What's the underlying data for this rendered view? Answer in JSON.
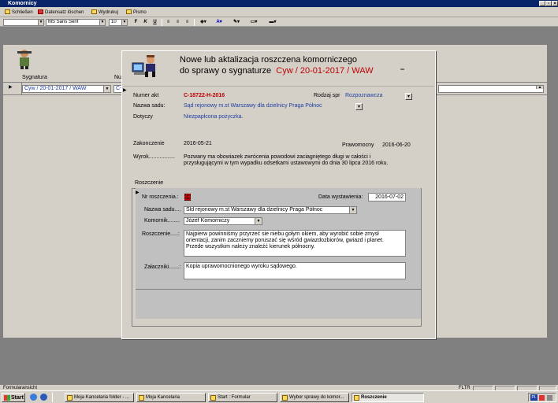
{
  "window": {
    "title": "Komornicy"
  },
  "menu": {
    "items": [
      "Schließen",
      "Datensatz löschen",
      "Wydrukuj",
      "Pismo"
    ]
  },
  "format": {
    "font": "MS Sans Serif",
    "size": "10",
    "bold": "F",
    "italic": "K",
    "underline": "U"
  },
  "background_form": {
    "label_syg": "Sygnatura",
    "label_nu": "Nu",
    "row_value": "Cyw / 20-01-2017 / WAW",
    "row_value2": "C-"
  },
  "dialog": {
    "title_line1": "Nowe lub aktalizacja roszczena  komorniczego",
    "title_line2_prefix": "do sprawy o sygnaturze",
    "title_line2_sig": "Cyw / 20-01-2017 / WAW",
    "numer_akt_label": "Numer akt",
    "numer_akt_value": "C-18722-H-2016",
    "rodzaj_label": "Rodzaj spr",
    "rodzaj_value": "Rozpoznawcza",
    "nazwa_sadu_label": "Nazwa sadu:",
    "nazwa_sadu_value": "Sąd rejonowy m.st  Warszawy dla dzielnicy Praga Północ",
    "dotyczy_label": "Dotyczy",
    "dotyczy_value": "Niezpapłcona pożyczka.",
    "zakonczenie_label": "Zakonczenie",
    "zakonczenie_value": "2016-05-21",
    "prawomocny_label": "Prawomocny",
    "prawomocny_value": "2016-06-20",
    "wyrok_label": "Wyrok.................",
    "wyrok_line1": "Pozwany ma obowiazek zwrócenia powodowi zaciagniętego długi  w całości i",
    "wyrok_line2": "przysługującymi w tym wypadku odsetkami ustawowymi do dnia 30 lipca 2016 roku.",
    "roszczenie_section": "Roszczenie"
  },
  "sub": {
    "nr_label": "Nr roszczenia.:",
    "nr_value": "1",
    "data_label": "Data wystawienia:",
    "data_value": "2016-07-02",
    "sad_label": "Nazwa sadu....",
    "sad_value": "Sld rejonowy m.st  Warszawy dla dzielnicy Praga Północ",
    "komornik_label": "Komornik........",
    "komornik_value": "Józef Komorniczy",
    "roszczenie_label": "Roszczenie.....:",
    "roszczenie_line1": "Najpierw powinniśmy przyrzeć sie niebu gołym okiem, aby wyrobić sobie zmysł",
    "roszczenie_line2": "orientacji, zanim zaczniemy poruszać się wśród gwiazdozbiorów, gwiazd i planet.",
    "roszczenie_line3": "Przede wszystkim należy znaleźć kierunek północny.",
    "zalaczniki_label": "Załaczniki.......:",
    "zalaczniki_value": "Kopia uprawomocnionego wyroku sądowego."
  },
  "status": {
    "left": "Formularansicht",
    "flags": "FLTR"
  },
  "taskbar": {
    "start": "Start",
    "tasks": [
      "Moja Kancelaria folder - ...",
      "Moja Kancelaria",
      "Start : Formular",
      "Wybor sprawy do komor...",
      "Roszczenie"
    ],
    "tray": "PL"
  }
}
